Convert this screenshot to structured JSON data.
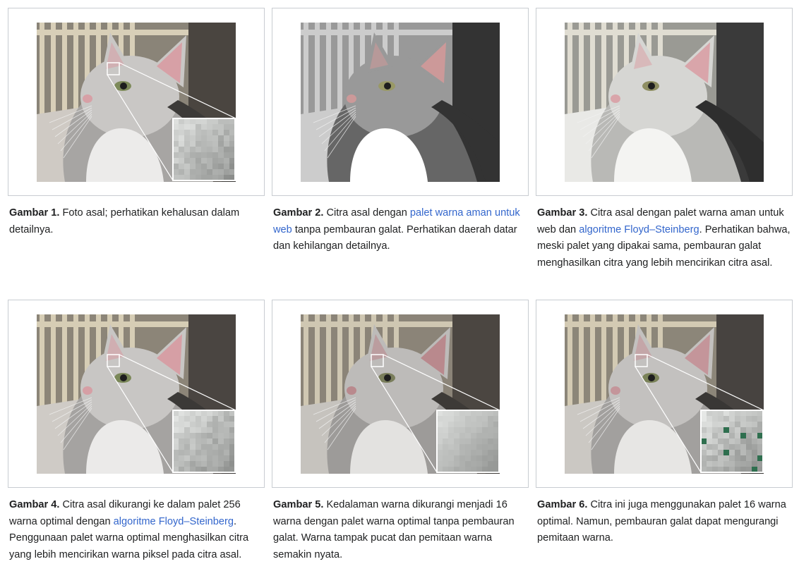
{
  "figures": [
    {
      "id": "fig1",
      "variant": "original",
      "has_inset": true,
      "caption": {
        "label": "Gambar 1.",
        "parts": [
          {
            "text": " Foto asal; perhatikan kehalusan dalam detailnya.",
            "link": false
          }
        ]
      }
    },
    {
      "id": "fig2",
      "variant": "websafe-no-dither",
      "has_inset": false,
      "caption": {
        "label": "Gambar 2.",
        "parts": [
          {
            "text": " Citra asal dengan ",
            "link": false
          },
          {
            "text": "palet warna aman untuk web",
            "link": true
          },
          {
            "text": " tanpa pembauran galat. Perhatikan daerah datar dan kehilangan detailnya.",
            "link": false
          }
        ]
      }
    },
    {
      "id": "fig3",
      "variant": "websafe-dither",
      "has_inset": false,
      "caption": {
        "label": "Gambar 3.",
        "parts": [
          {
            "text": " Citra asal dengan palet warna aman untuk web dan ",
            "link": false
          },
          {
            "text": "algoritme Floyd–Steinberg",
            "link": true
          },
          {
            "text": ". Perhatikan bahwa, meski palet yang dipakai sama, pembauran galat menghasilkan citra yang lebih mencirikan citra asal.",
            "link": false
          }
        ]
      }
    },
    {
      "id": "fig4",
      "variant": "256-dither",
      "has_inset": true,
      "caption": {
        "label": "Gambar 4.",
        "parts": [
          {
            "text": " Citra asal dikurangi ke dalam palet 256 warna optimal dengan ",
            "link": false
          },
          {
            "text": "algoritme Floyd–Steinberg",
            "link": true
          },
          {
            "text": ". Penggunaan palet warna optimal menghasilkan citra yang lebih mencirikan warna piksel pada citra asal.",
            "link": false
          }
        ]
      }
    },
    {
      "id": "fig5",
      "variant": "16-no-dither",
      "has_inset": true,
      "caption": {
        "label": "Gambar 5.",
        "parts": [
          {
            "text": " Kedalaman warna dikurangi menjadi 16 warna dengan palet warna optimal tanpa pembauran galat. Warna tampak pucat dan pemitaan warna semakin nyata.",
            "link": false
          }
        ]
      }
    },
    {
      "id": "fig6",
      "variant": "16-dither",
      "has_inset": true,
      "caption": {
        "label": "Gambar 6.",
        "parts": [
          {
            "text": " Citra ini juga menggunakan palet 16 warna optimal. Namun, pembauran galat dapat mengurangi pemitaan warna.",
            "link": false
          }
        ]
      }
    }
  ],
  "colors": {
    "link": "#3366cc",
    "border": "#c8ccd1",
    "text": "#202122"
  }
}
